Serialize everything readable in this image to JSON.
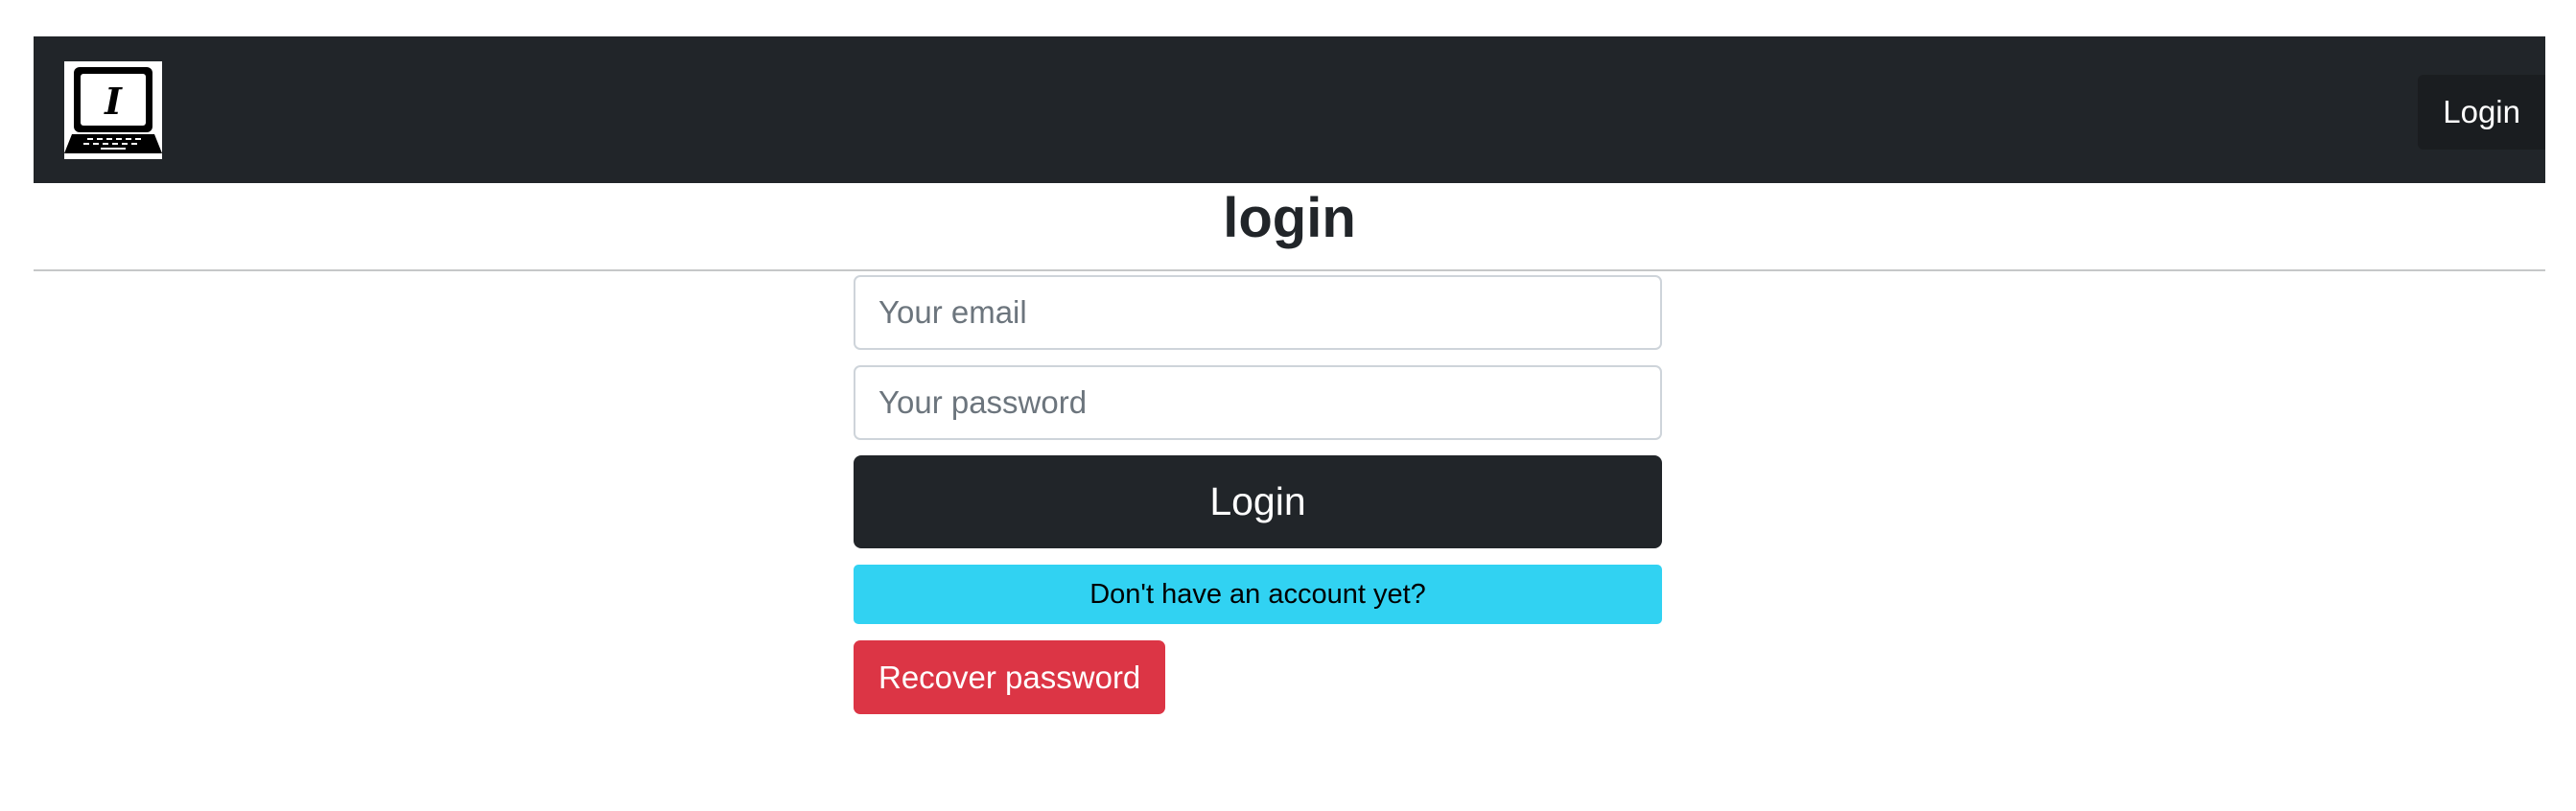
{
  "navbar": {
    "logo_icon": "laptop-italic-i-icon",
    "logo_glyph": "I",
    "login_label": "Login",
    "background": "#212529"
  },
  "page": {
    "title": "login"
  },
  "form": {
    "email": {
      "placeholder": "Your email",
      "value": ""
    },
    "password": {
      "placeholder": "Your password",
      "value": ""
    },
    "login_label": "Login",
    "signup_label": "Don't have an account yet?",
    "recover_label": "Recover password"
  },
  "colors": {
    "dark": "#212529",
    "info": "#31d2f2",
    "danger": "#dc3545"
  }
}
